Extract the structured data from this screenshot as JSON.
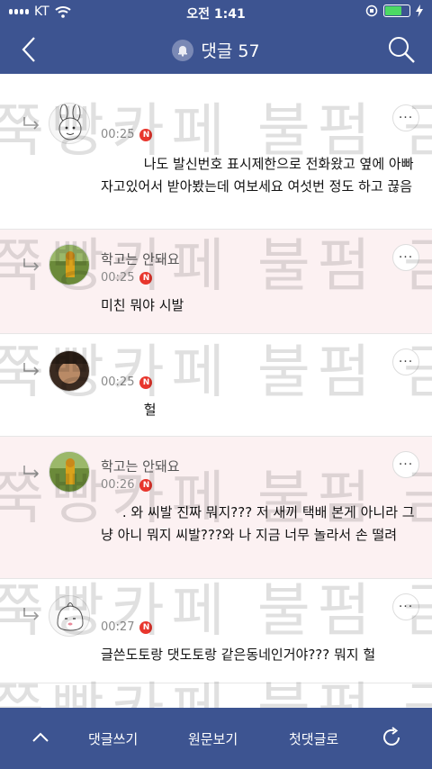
{
  "status_bar": {
    "carrier": "KT",
    "time": "오전 1:41"
  },
  "header": {
    "title": "댓글 57",
    "icons": {
      "back": "back-arrow-icon",
      "bell": "bell-icon",
      "search": "search-icon"
    }
  },
  "watermark": "쭉빵카페 불펌 금지",
  "comments": [
    {
      "author": "",
      "time": "00:25",
      "badge": "N",
      "text": "          나도 발신번호 표시제한으로 전화왔고 옆에 아빠 자고있어서 받아봤는데 여보세요 여섯번 정도 하고 끊음",
      "more": "···",
      "highlight": false
    },
    {
      "author": "학고는 안돼요",
      "time": "00:25",
      "badge": "N",
      "text": "미친 뭐야 시발",
      "more": "···",
      "highlight": true
    },
    {
      "author": "",
      "time": "00:25",
      "badge": "N",
      "text": "          헐",
      "more": "···",
      "highlight": false
    },
    {
      "author": "학고는 안돼요",
      "time": "00:26",
      "badge": "N",
      "text": "     . 와 씨발 진짜 뭐지??? 저 새끼 택배 본게 아니라 그냥 아니 뭐지 씨발???와 나 지금 너무 놀라서 손 떨려",
      "more": "···",
      "highlight": true
    },
    {
      "author": "",
      "time": "00:27",
      "badge": "N",
      "text": "글쓴도토랑 댓도토랑 같은동네인거야??? 뭐지 헐",
      "more": "···",
      "highlight": false
    }
  ],
  "bottom_bar": {
    "write": "댓글쓰기",
    "view_original": "원문보기",
    "first_comment": "첫댓글로"
  },
  "colors": {
    "nav": "#3d5491",
    "highlight_row": "#fcf1f2",
    "badge": "#e8362d"
  }
}
